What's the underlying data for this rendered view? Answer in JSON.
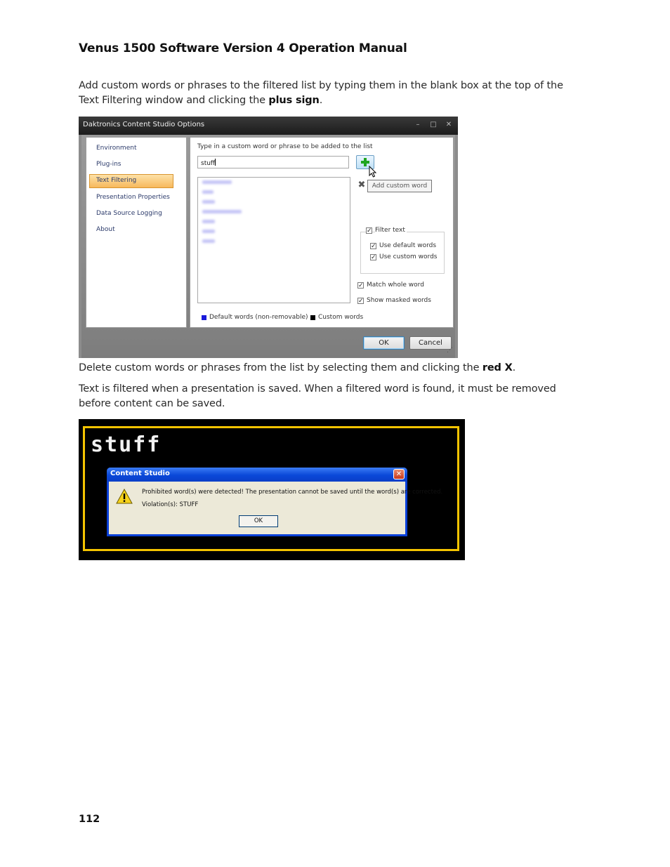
{
  "document": {
    "title": "Venus 1500 Software Version 4 Operation Manual",
    "para1_a": "Add custom words or phrases to the filtered list by typing them in the blank box at the top of the Text Filtering window and clicking the ",
    "para1_b": "plus sign",
    "para1_c": ".",
    "para2_a": "Delete custom words or phrases from the list by selecting them and clicking the ",
    "para2_b": "red X",
    "para2_c": ".",
    "para3": "Text is filtered when a presentation is saved. When a filtered word is found, it must be removed before content can be saved.",
    "page_number": "112"
  },
  "options_dialog": {
    "title": "Daktronics Content Studio Options",
    "window_buttons": [
      "–",
      "□",
      "✕"
    ],
    "nav_items": [
      "Environment",
      "Plug-ins",
      "Text Filtering",
      "Presentation Properties",
      "Data Source Logging",
      "About"
    ],
    "selected_nav": "Text Filtering",
    "instruction": "Type in a custom word or phrase to be added to the list",
    "input_value": "stuff",
    "add_tooltip": "Add custom word",
    "remove_symbol": "✖",
    "filter_text_label": "Filter text",
    "use_default_words": "Use default words",
    "use_custom_words": "Use custom words",
    "match_whole_word": "Match whole word",
    "show_masked_words": "Show masked words",
    "check_mark": "✓",
    "legend_default": "Default words (non-removable)",
    "legend_custom": "Custom words",
    "ok_label": "OK",
    "cancel_label": "Cancel",
    "colors": {
      "default_words": "#1a1adb",
      "custom_words": "#000000",
      "nav_selected": "#f7b85c"
    }
  },
  "alert_screenshot": {
    "display_text": "stuff",
    "window_title": "Content Studio",
    "message": "Prohibited word(s) were detected! The presentation cannot be saved until the word(s) are corrected.",
    "violations": "Violation(s): STUFF",
    "ok_label": "OK",
    "close_symbol": "✕",
    "icon": "warning-icon",
    "colors": {
      "frame": "#f5c400",
      "titlebar": "#0a48d8"
    }
  }
}
